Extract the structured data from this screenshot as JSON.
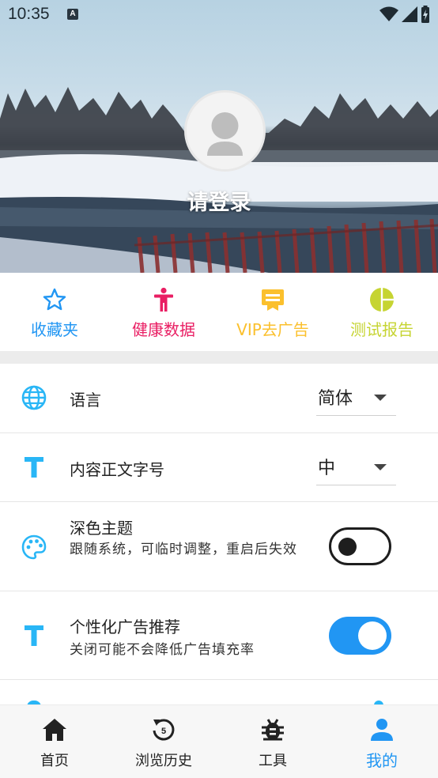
{
  "status_bar": {
    "time": "10:35",
    "notification_badge": "A",
    "icons": [
      "wifi-icon",
      "cellular-signal-icon",
      "battery-charging-icon"
    ]
  },
  "profile": {
    "login_prompt": "请登录",
    "avatar_icon": "person-avatar-icon"
  },
  "quick_actions": [
    {
      "label": "收藏夹",
      "icon": "star-icon",
      "color": "#2196f3"
    },
    {
      "label": "健康数据",
      "icon": "human-figure-icon",
      "color": "#e91e63"
    },
    {
      "label": "VIP去广告",
      "icon": "vip-ticket-icon",
      "color": "#fbc02d"
    },
    {
      "label": "测试报告",
      "icon": "pie-chart-icon",
      "color": "#c6d432"
    }
  ],
  "settings": {
    "language": {
      "title": "语言",
      "value": "简体",
      "icon": "globe-icon"
    },
    "font_size": {
      "title": "内容正文字号",
      "value": "中",
      "icon": "text-t-icon"
    },
    "dark_theme": {
      "title": "深色主题",
      "subtitle": "跟随系统，可临时调整，重启后失效",
      "enabled": false,
      "icon": "palette-icon"
    },
    "personalized_ads": {
      "title": "个性化广告推荐",
      "subtitle": "关闭可能不会降低广告填充率",
      "enabled": true,
      "icon": "text-t-icon"
    }
  },
  "bottom_nav": [
    {
      "label": "首页",
      "icon": "home-icon",
      "active": false
    },
    {
      "label": "浏览历史",
      "icon": "history-icon",
      "active": false
    },
    {
      "label": "工具",
      "icon": "bug-tool-icon",
      "active": false
    },
    {
      "label": "我的",
      "icon": "person-icon",
      "active": true
    }
  ],
  "colors": {
    "accent": "#2196f3",
    "icon_blue": "#29b6f6",
    "toggle_off": "#1e1e1e"
  }
}
